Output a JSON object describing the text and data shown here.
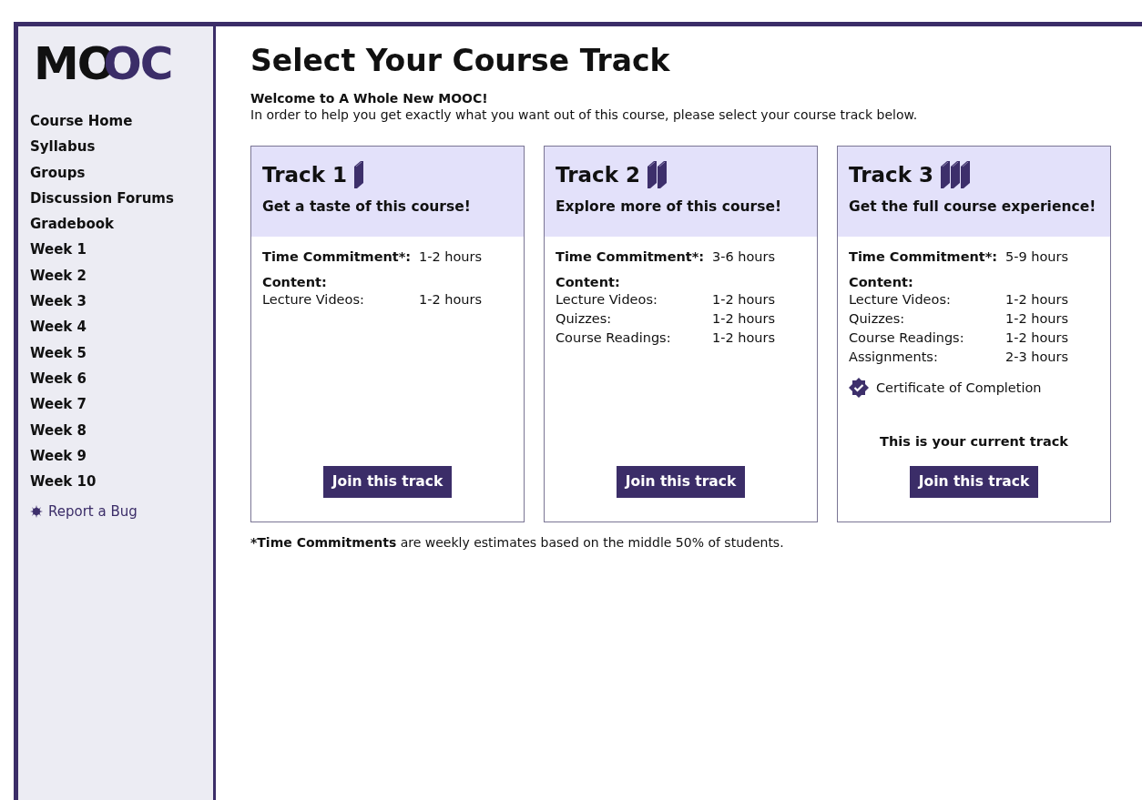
{
  "logo": {
    "dark": "MO",
    "accent": "OC"
  },
  "sidebar": {
    "items": [
      {
        "label": "Course Home"
      },
      {
        "label": "Syllabus"
      },
      {
        "label": "Groups"
      },
      {
        "label": "Discussion Forums"
      },
      {
        "label": "Gradebook"
      },
      {
        "label": "Week 1"
      },
      {
        "label": "Week 2"
      },
      {
        "label": "Week 3"
      },
      {
        "label": "Week 4"
      },
      {
        "label": "Week 5"
      },
      {
        "label": "Week 6"
      },
      {
        "label": "Week 7"
      },
      {
        "label": "Week 8"
      },
      {
        "label": "Week 9"
      },
      {
        "label": "Week 10"
      }
    ],
    "report_link": "Report a Bug"
  },
  "page": {
    "title": "Select Your Course Track",
    "welcome": "Welcome to A Whole New MOOC!",
    "intro": "In order to help you get exactly what you want out of this course, please select your course track below."
  },
  "tracks": [
    {
      "title": "Track 1",
      "kind": "one-book",
      "tagline": "Get a taste of this course!",
      "commitment_label": "Time Commitment*:",
      "commitment": "1-2 hours",
      "content_label": "Content:",
      "content": [
        {
          "name": "Lecture Videos:",
          "time": "1-2 hours"
        }
      ],
      "button": "Join this track"
    },
    {
      "title": "Track 2",
      "kind": "two-books",
      "tagline": "Explore more of this course!",
      "commitment_label": "Time Commitment*:",
      "commitment": "3-6 hours",
      "content_label": "Content:",
      "content": [
        {
          "name": "Lecture Videos:",
          "time": "1-2 hours"
        },
        {
          "name": "Quizzes:",
          "time": "1-2 hours"
        },
        {
          "name": "Course Readings:",
          "time": "1-2 hours"
        }
      ],
      "button": "Join this track"
    },
    {
      "title": "Track 3",
      "kind": "three-books",
      "tagline": "Get the full course experience!",
      "commitment_label": "Time Commitment*:",
      "commitment": "5-9 hours",
      "content_label": "Content:",
      "content": [
        {
          "name": "Lecture Videos:",
          "time": "1-2 hours"
        },
        {
          "name": "Quizzes:",
          "time": "1-2 hours"
        },
        {
          "name": "Course Readings:",
          "time": "1-2 hours"
        },
        {
          "name": "Assignments:",
          "time": "2-3 hours"
        }
      ],
      "certificate": "Certificate of Completion",
      "current_note": "This is your current track",
      "button": "Join this track"
    }
  ],
  "footnote": "***Time Commitments** are weekly estimates based on the middle 50% of students."
}
